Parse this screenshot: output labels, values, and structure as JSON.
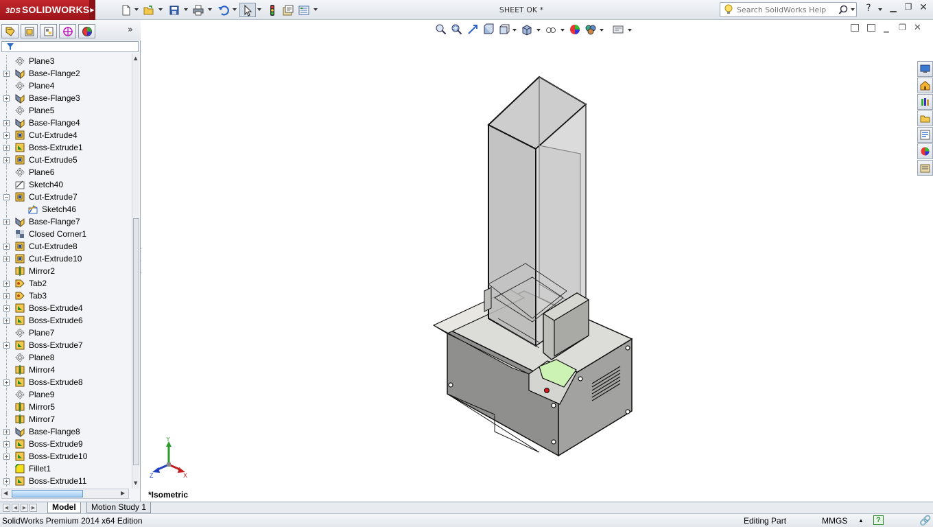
{
  "app": {
    "logo_text": "SOLIDWORKS",
    "logo_prefix": "3DS",
    "document_title": "SHEET OK *",
    "help_search_placeholder": "Search SolidWorks Help",
    "brand_color": "#b01e24"
  },
  "toolbar": {
    "items": [
      "new-icon",
      "open-icon",
      "save-icon",
      "print-icon",
      "undo-icon",
      "select-icon",
      "rebuild-icon",
      "file-properties-icon",
      "options-icon"
    ]
  },
  "feature_panel": {
    "tabs": [
      "feature-manager-icon",
      "property-manager-icon",
      "configuration-manager-icon",
      "dimxpert-icon",
      "display-manager-icon"
    ],
    "tree": [
      {
        "label": "Plane3",
        "icon": "plane",
        "expandable": false
      },
      {
        "label": "Base-Flange2",
        "icon": "sheetmetal",
        "expandable": true
      },
      {
        "label": "Plane4",
        "icon": "plane",
        "expandable": false
      },
      {
        "label": "Base-Flange3",
        "icon": "sheetmetal",
        "expandable": true
      },
      {
        "label": "Plane5",
        "icon": "plane",
        "expandable": false
      },
      {
        "label": "Base-Flange4",
        "icon": "sheetmetal",
        "expandable": true
      },
      {
        "label": "Cut-Extrude4",
        "icon": "cut",
        "expandable": true
      },
      {
        "label": "Boss-Extrude1",
        "icon": "boss",
        "expandable": true
      },
      {
        "label": "Cut-Extrude5",
        "icon": "cut",
        "expandable": true
      },
      {
        "label": "Plane6",
        "icon": "plane",
        "expandable": false
      },
      {
        "label": "Sketch40",
        "icon": "sketch",
        "expandable": false
      },
      {
        "label": "Cut-Extrude7",
        "icon": "cut",
        "expandable": true,
        "expanded": true
      },
      {
        "label": "Sketch46",
        "icon": "sketch-child",
        "expandable": false,
        "child": true
      },
      {
        "label": "Base-Flange7",
        "icon": "sheetmetal",
        "expandable": true
      },
      {
        "label": "Closed Corner1",
        "icon": "corner",
        "expandable": false
      },
      {
        "label": "Cut-Extrude8",
        "icon": "cut",
        "expandable": true
      },
      {
        "label": "Cut-Extrude10",
        "icon": "cut",
        "expandable": true
      },
      {
        "label": "Mirror2",
        "icon": "mirror",
        "expandable": false
      },
      {
        "label": "Tab2",
        "icon": "tab",
        "expandable": true
      },
      {
        "label": "Tab3",
        "icon": "tab",
        "expandable": true
      },
      {
        "label": "Boss-Extrude4",
        "icon": "boss",
        "expandable": true
      },
      {
        "label": "Boss-Extrude6",
        "icon": "boss",
        "expandable": true
      },
      {
        "label": "Plane7",
        "icon": "plane",
        "expandable": false
      },
      {
        "label": "Boss-Extrude7",
        "icon": "boss",
        "expandable": true
      },
      {
        "label": "Plane8",
        "icon": "plane",
        "expandable": false
      },
      {
        "label": "Mirror4",
        "icon": "mirror",
        "expandable": false
      },
      {
        "label": "Boss-Extrude8",
        "icon": "boss",
        "expandable": true
      },
      {
        "label": "Plane9",
        "icon": "plane",
        "expandable": false
      },
      {
        "label": "Mirror5",
        "icon": "mirror",
        "expandable": false
      },
      {
        "label": "Mirror7",
        "icon": "mirror",
        "expandable": false
      },
      {
        "label": "Base-Flange8",
        "icon": "sheetmetal",
        "expandable": true
      },
      {
        "label": "Boss-Extrude9",
        "icon": "boss",
        "expandable": true
      },
      {
        "label": "Boss-Extrude10",
        "icon": "boss",
        "expandable": true
      },
      {
        "label": "Fillet1",
        "icon": "fillet",
        "expandable": false
      },
      {
        "label": "Boss-Extrude11",
        "icon": "boss",
        "expandable": true
      }
    ]
  },
  "viewport": {
    "view_name": "*Isometric",
    "triad": {
      "x": "X",
      "y": "Y",
      "z": "Z"
    }
  },
  "bottom_tabs": {
    "model": "Model",
    "motion": "Motion Study 1"
  },
  "status": {
    "edition": "SolidWorks Premium 2014 x64 Edition",
    "mode": "Editing Part",
    "units": "MMGS"
  }
}
